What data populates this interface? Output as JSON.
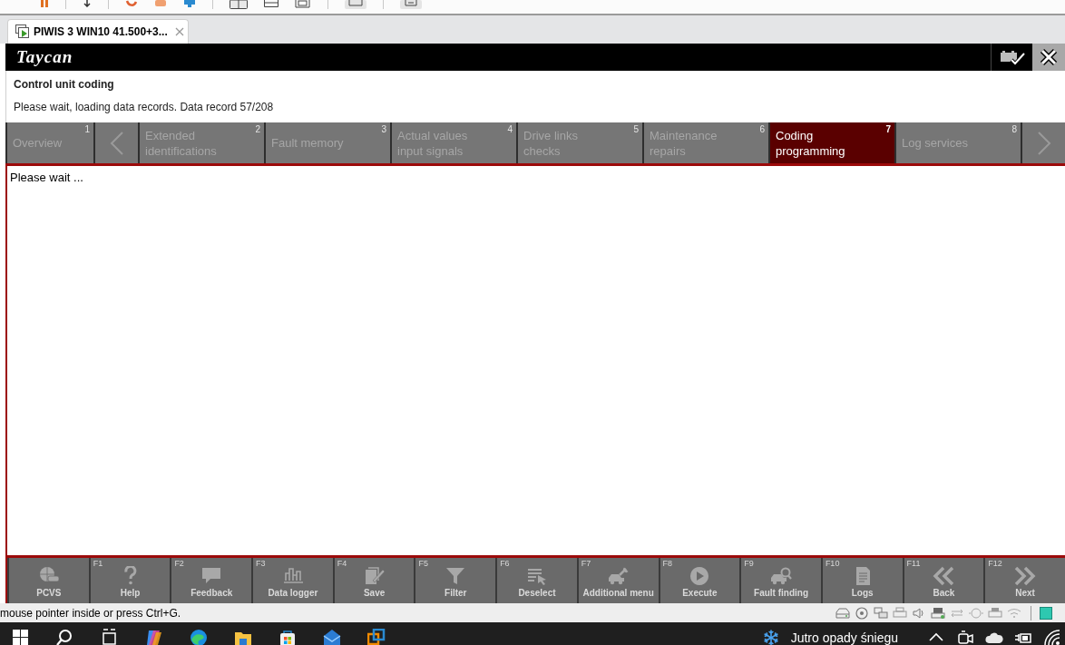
{
  "vm_tabs": [
    {
      "title": "PIWIS 3 WIN10 41.500+3...",
      "selected": true
    }
  ],
  "app": {
    "logo": "Taycan",
    "page_title": "Control unit coding",
    "message": "Please wait, loading data records. Data record 57/208",
    "nav": [
      {
        "kind": "tab",
        "number": "1",
        "label": "Overview",
        "selected": false,
        "disabled": true
      },
      {
        "kind": "prev",
        "selected": false,
        "disabled": true
      },
      {
        "kind": "tab",
        "number": "2",
        "label": "Extended\nidentifications",
        "selected": false,
        "disabled": true
      },
      {
        "kind": "tab",
        "number": "3",
        "label": "Fault memory",
        "selected": false,
        "disabled": true
      },
      {
        "kind": "tab",
        "number": "4",
        "label": "Actual values\ninput signals",
        "selected": false,
        "disabled": true
      },
      {
        "kind": "tab",
        "number": "5",
        "label": "Drive links\nchecks",
        "selected": false,
        "disabled": true
      },
      {
        "kind": "tab",
        "number": "6",
        "label": "Maintenance\nrepairs",
        "selected": false,
        "disabled": true
      },
      {
        "kind": "tab",
        "number": "7",
        "label": "Coding\nprogramming",
        "selected": true,
        "disabled": false
      },
      {
        "kind": "tab",
        "number": "8",
        "label": "Log services",
        "selected": false,
        "disabled": true
      },
      {
        "kind": "next",
        "selected": false,
        "disabled": true
      }
    ],
    "content_text": "Please wait ...",
    "function_keys": [
      {
        "label": "PCVS",
        "disabled": true
      },
      {
        "key": "F1",
        "label": "Help",
        "disabled": true
      },
      {
        "key": "F2",
        "label": "Feedback",
        "disabled": true
      },
      {
        "key": "F3",
        "label": "Data logger",
        "disabled": true
      },
      {
        "key": "F4",
        "label": "Save",
        "disabled": true
      },
      {
        "key": "F5",
        "label": "Filter",
        "disabled": true
      },
      {
        "key": "F6",
        "label": "Deselect",
        "disabled": true
      },
      {
        "key": "F7",
        "label": "Additional menu",
        "disabled": true
      },
      {
        "key": "F8",
        "label": "Execute",
        "disabled": true
      },
      {
        "key": "F9",
        "label": "Fault finding",
        "disabled": true
      },
      {
        "key": "F10",
        "label": "Logs",
        "disabled": true
      },
      {
        "key": "F11",
        "label": "Back",
        "disabled": true
      },
      {
        "key": "F12",
        "label": "Next",
        "disabled": true
      }
    ]
  },
  "status_bar": {
    "text": "mouse pointer inside or press Ctrl+G."
  },
  "taskbar": {
    "weather": "Jutro opady śniegu"
  }
}
